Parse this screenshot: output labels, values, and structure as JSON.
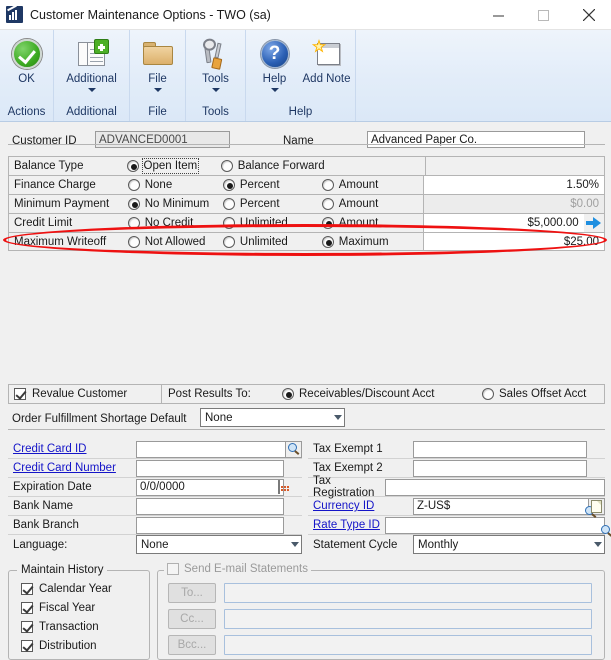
{
  "window": {
    "title": "Customer Maintenance Options  -  TWO (sa)",
    "icon": "chart-app-icon",
    "minimize_label": "Minimize",
    "maximize_label": "Maximize",
    "close_label": "Close"
  },
  "ribbon": {
    "groups": [
      {
        "label": "Actions",
        "buttons": [
          {
            "label": "OK",
            "icon": "green-check-icon",
            "has_caret": false
          }
        ]
      },
      {
        "label": "Additional",
        "buttons": [
          {
            "label": "Additional",
            "icon": "page-plus-icon",
            "has_caret": true
          }
        ]
      },
      {
        "label": "File",
        "buttons": [
          {
            "label": "File",
            "icon": "folder-icon",
            "has_caret": true
          }
        ]
      },
      {
        "label": "Tools",
        "buttons": [
          {
            "label": "Tools",
            "icon": "wrench-screwdriver-icon",
            "has_caret": true
          }
        ]
      },
      {
        "label": "Help",
        "buttons": [
          {
            "label": "Help",
            "icon": "blue-question-icon",
            "has_caret": true
          },
          {
            "label": "Add Note",
            "icon": "note-star-icon",
            "has_caret": false
          }
        ]
      }
    ]
  },
  "header": {
    "customer_id_label": "Customer ID",
    "customer_id_value": "ADVANCED0001",
    "name_label": "Name",
    "name_value": "Advanced Paper Co."
  },
  "options": {
    "rows": [
      {
        "label": "Balance Type",
        "choices": [
          {
            "label": "Open Item",
            "selected": true,
            "focused": true
          },
          {
            "label": "Balance Forward",
            "selected": false,
            "focused": false
          }
        ],
        "value": "",
        "value_state": "none"
      },
      {
        "label": "Finance Charge",
        "choices": [
          {
            "label": "None",
            "selected": false,
            "focused": false
          },
          {
            "label": "Percent",
            "selected": true,
            "focused": false
          },
          {
            "label": "Amount",
            "selected": false,
            "focused": false
          }
        ],
        "value": "1.50%",
        "value_state": "enabled"
      },
      {
        "label": "Minimum Payment",
        "choices": [
          {
            "label": "No Minimum",
            "selected": true,
            "focused": false
          },
          {
            "label": "Percent",
            "selected": false,
            "focused": false
          },
          {
            "label": "Amount",
            "selected": false,
            "focused": false
          }
        ],
        "value": "$0.00",
        "value_state": "disabled"
      },
      {
        "label": "Credit Limit",
        "choices": [
          {
            "label": "No Credit",
            "selected": false,
            "focused": false
          },
          {
            "label": "Unlimited",
            "selected": false,
            "focused": false
          },
          {
            "label": "Amount",
            "selected": true,
            "focused": false
          }
        ],
        "value": "$5,000.00",
        "value_state": "enabled",
        "has_arrow": true,
        "highlighted": true
      },
      {
        "label": "Maximum Writeoff",
        "choices": [
          {
            "label": "Not Allowed",
            "selected": false,
            "focused": false
          },
          {
            "label": "Unlimited",
            "selected": false,
            "focused": false
          },
          {
            "label": "Maximum",
            "selected": true,
            "focused": false
          }
        ],
        "value": "$25.00",
        "value_state": "enabled"
      }
    ]
  },
  "revalue": {
    "checkbox_label": "Revalue Customer",
    "checked": true,
    "post_label": "Post Results To:",
    "post_choices": [
      {
        "label": "Receivables/Discount Acct",
        "selected": true
      },
      {
        "label": "Sales Offset Acct",
        "selected": false
      }
    ]
  },
  "order_fulfillment": {
    "label": "Order Fulfillment Shortage Default",
    "value": "None"
  },
  "left_fields": [
    {
      "label": "Credit Card ID",
      "is_link": true,
      "value": "",
      "lookup": true,
      "calendar": false
    },
    {
      "label": "Credit Card Number",
      "is_link": true,
      "value": "",
      "lookup": false,
      "calendar": false
    },
    {
      "label": "Expiration Date",
      "is_link": false,
      "value": "0/0/0000",
      "lookup": false,
      "calendar": true
    },
    {
      "label": "Bank Name",
      "is_link": false,
      "value": "",
      "lookup": false,
      "calendar": false
    },
    {
      "label": "Bank Branch",
      "is_link": false,
      "value": "",
      "lookup": false,
      "calendar": false
    }
  ],
  "language": {
    "label": "Language:",
    "value": "None"
  },
  "right_fields": [
    {
      "label": "Tax Exempt 1",
      "is_link": false,
      "value": "",
      "lookup": false,
      "note": false,
      "narrow": false
    },
    {
      "label": "Tax Exempt 2",
      "is_link": false,
      "value": "",
      "lookup": false,
      "note": false,
      "narrow": false
    },
    {
      "label": "Tax Registration",
      "is_link": false,
      "value": "",
      "lookup": false,
      "note": false,
      "narrow": true
    },
    {
      "label": "Currency ID",
      "is_link": true,
      "value": "Z-US$",
      "lookup": true,
      "note": true,
      "narrow": false
    },
    {
      "label": "Rate Type ID",
      "is_link": true,
      "value": "",
      "lookup": true,
      "note": false,
      "narrow": true
    }
  ],
  "statement_cycle": {
    "label": "Statement Cycle",
    "value": "Monthly"
  },
  "maintain_history": {
    "legend": "Maintain History",
    "items": [
      {
        "label": "Calendar Year",
        "checked": true
      },
      {
        "label": "Fiscal Year",
        "checked": true
      },
      {
        "label": "Transaction",
        "checked": true
      },
      {
        "label": "Distribution",
        "checked": true
      }
    ]
  },
  "email_statements": {
    "legend": "Send E-mail Statements",
    "checked": false,
    "enabled": false,
    "rows": [
      {
        "button": "To...",
        "value": ""
      },
      {
        "button": "Cc...",
        "value": ""
      },
      {
        "button": "Bcc...",
        "value": ""
      }
    ]
  },
  "annotation": {
    "type": "red-ellipse",
    "color": "#ee1111",
    "targets": "Credit Limit"
  }
}
